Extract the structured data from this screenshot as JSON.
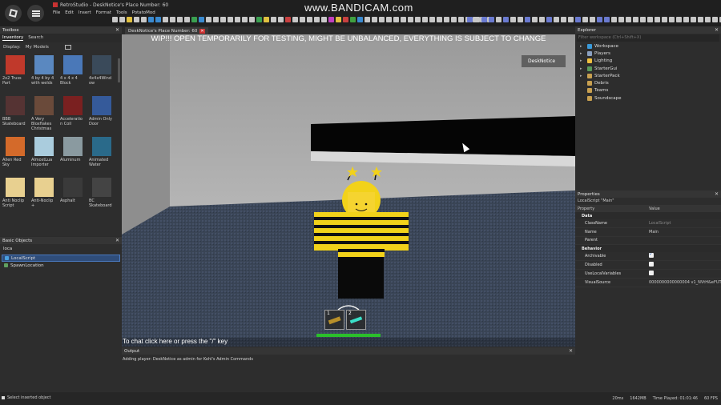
{
  "titlebar": {
    "title": "RetroStudio - DeskNotice's Place Number: 60",
    "menus": [
      "File",
      "Edit",
      "Insert",
      "Format",
      "Tools",
      "PotatoMod"
    ],
    "recorder_watermark": "www.BANDICAM.com"
  },
  "toolbox": {
    "title": "Toolbox",
    "tabs": [
      "Inventory",
      "Search"
    ],
    "display_label": "Display:",
    "display_value": "My Models",
    "items": [
      {
        "label": "2x2 Truss Part",
        "color": "#c0392b"
      },
      {
        "label": "4 by 4 by 4 with welds",
        "color": "#5a88c0"
      },
      {
        "label": "4 x 4 x 4 Block",
        "color": "#4a78b8"
      },
      {
        "label": "4x4x4Wind ow",
        "color": "#3a4a5a"
      },
      {
        "label": "BBB Skateboard",
        "color": "#553333"
      },
      {
        "label": "A Very Bloxflakes Christmas",
        "color": "#6a4a3a"
      },
      {
        "label": "Acceleratio n Coil",
        "color": "#7a2020"
      },
      {
        "label": "Admin Only Door",
        "color": "#355a9a"
      },
      {
        "label": "Alien Red Sky",
        "color": "#d46a2a"
      },
      {
        "label": "AlmostLua Importer",
        "color": "#aaccdd"
      },
      {
        "label": "Aluminum",
        "color": "#8a9aa0"
      },
      {
        "label": "Animated Water",
        "color": "#2a6a8a"
      },
      {
        "label": "Anti Noclip Script",
        "color": "#e8d090"
      },
      {
        "label": "Anti-Noclip +",
        "color": "#e8d090"
      },
      {
        "label": "Asphalt",
        "color": "#3a3a3a"
      },
      {
        "label": "BC Skateboard",
        "color": "#444444"
      }
    ]
  },
  "basic_objects": {
    "title": "Basic Objects",
    "search_value": "loca",
    "items": [
      {
        "label": "LocalScript",
        "selected": true
      },
      {
        "label": "SpawnLocation",
        "selected": false
      }
    ]
  },
  "document_tab": {
    "label": "DeskNotice's Place Number: 60"
  },
  "viewport": {
    "banner": "WIP!!! OPEN TEMPORARILY FOR TESTING, MIGHT BE UNBALANCED, EVERYTHING IS SUBJECT TO CHANGE",
    "player_name": "DeskNotice",
    "chat_hint": "To chat click here or press the \"/\" key",
    "hotbar_slots": [
      "1",
      "2"
    ],
    "health_fraction": 1.0
  },
  "output": {
    "title": "Output",
    "lines": [
      "Adding player: DeskNotice as admin for Kohl's Admin Commands"
    ]
  },
  "explorer": {
    "title": "Explorer",
    "filter_placeholder": "Filter workspace (Ctrl+Shift+X)",
    "items": [
      {
        "label": "Workspace",
        "expandable": true,
        "icon_color": "#3a9ad9"
      },
      {
        "label": "Players",
        "expandable": true,
        "icon_color": "#8aa0c0"
      },
      {
        "label": "Lighting",
        "expandable": true,
        "icon_color": "#f0c040"
      },
      {
        "label": "StarterGui",
        "expandable": true,
        "icon_color": "#5a9a5a"
      },
      {
        "label": "StarterPack",
        "expandable": true,
        "icon_color": "#c8a050"
      },
      {
        "label": "Debris",
        "expandable": false,
        "icon_color": "#c8a050"
      },
      {
        "label": "Teams",
        "expandable": false,
        "icon_color": "#c8a050"
      },
      {
        "label": "Soundscape",
        "expandable": false,
        "icon_color": "#c8a050"
      }
    ]
  },
  "properties": {
    "title": "Properties",
    "subtitle": "LocalScript \"Main\"",
    "col_property": "Property",
    "col_value": "Value",
    "data_label": "Data",
    "behavior_label": "Behavior",
    "data_rows": [
      {
        "name": "ClassName",
        "value": "LocalScript",
        "dim": true
      },
      {
        "name": "Name",
        "value": "Main",
        "dim": false
      },
      {
        "name": "Parent",
        "value": "",
        "dim": false
      }
    ],
    "behavior_rows": [
      {
        "name": "Archivable",
        "checked": true
      },
      {
        "name": "Disabled",
        "checked": false
      },
      {
        "name": "UseLocalVariables",
        "checked": false
      }
    ],
    "visual_source": {
      "name": "VisualSource",
      "value": "0000000000000004 v1_NVtH&eFUTcBl"
    }
  },
  "statusbar": {
    "left": "Select inserted object",
    "ping": "20ms",
    "memory": "1642MB",
    "time_played": "Time Played: 01:01:46",
    "fps": "60 FPS"
  },
  "colors": {
    "panel_bg": "#2d2d2d",
    "header_bg": "#353535",
    "selection": "#2f4d7a",
    "health": "#2bbf2b",
    "bee_yellow": "#f2d21a"
  }
}
